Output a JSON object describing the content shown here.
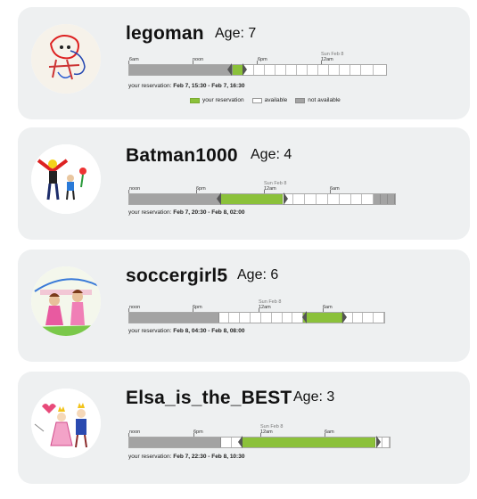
{
  "reservation_label": "your reservation:",
  "legend": {
    "reservation": "your reservation",
    "available": "available",
    "not_available": "not available"
  },
  "colors": {
    "reservation": "#8bc13a",
    "available": "#ffffff",
    "not_available": "#a3a3a3",
    "card_bg": "#eef0f1"
  },
  "cards": [
    {
      "name": "legoman",
      "age": "Age: 7",
      "reservation": "Feb 7, 15:30 - Feb 7, 16:30",
      "day_header": "Sun Feb 8",
      "ticks": [
        "6am",
        "noon",
        "6pm",
        "12am"
      ],
      "slots_pattern": "na:19,res:2,av:12",
      "avatar_icon": "child-drawing-red-figure-icon"
    },
    {
      "name": "Batman1000",
      "age": "Age: 4",
      "reservation": "Feb 7, 20:30 - Feb 8, 02:00",
      "day_header": "Sun Feb 8",
      "ticks": [
        "noon",
        "6pm",
        "12am",
        "6am"
      ],
      "slots_pattern": "na:17,res:11,av:16,na:3",
      "avatar_icon": "child-drawing-batman-icon"
    },
    {
      "name": "soccergirl5",
      "age": "Age: 6",
      "reservation": "Feb 8, 04:30 - Feb 8, 08:00",
      "day_header": "Sun Feb 8",
      "ticks": [
        "noon",
        "6pm",
        "12am",
        "6am"
      ],
      "slots_pattern": "na:17,av:16,res:7,av:8",
      "avatar_icon": "child-drawing-two-girls-icon"
    },
    {
      "name": "Elsa_is_the_BEST",
      "age": "Age: 3",
      "reservation": "Feb 7, 22:30 - Feb 8, 10:30",
      "day_header": "Sun Feb 8",
      "ticks": [
        "noon",
        "6pm",
        "12am",
        "6am"
      ],
      "slots_pattern": "na:17,av:4,res:24,av:3",
      "avatar_icon": "child-drawing-princesses-icon"
    }
  ]
}
